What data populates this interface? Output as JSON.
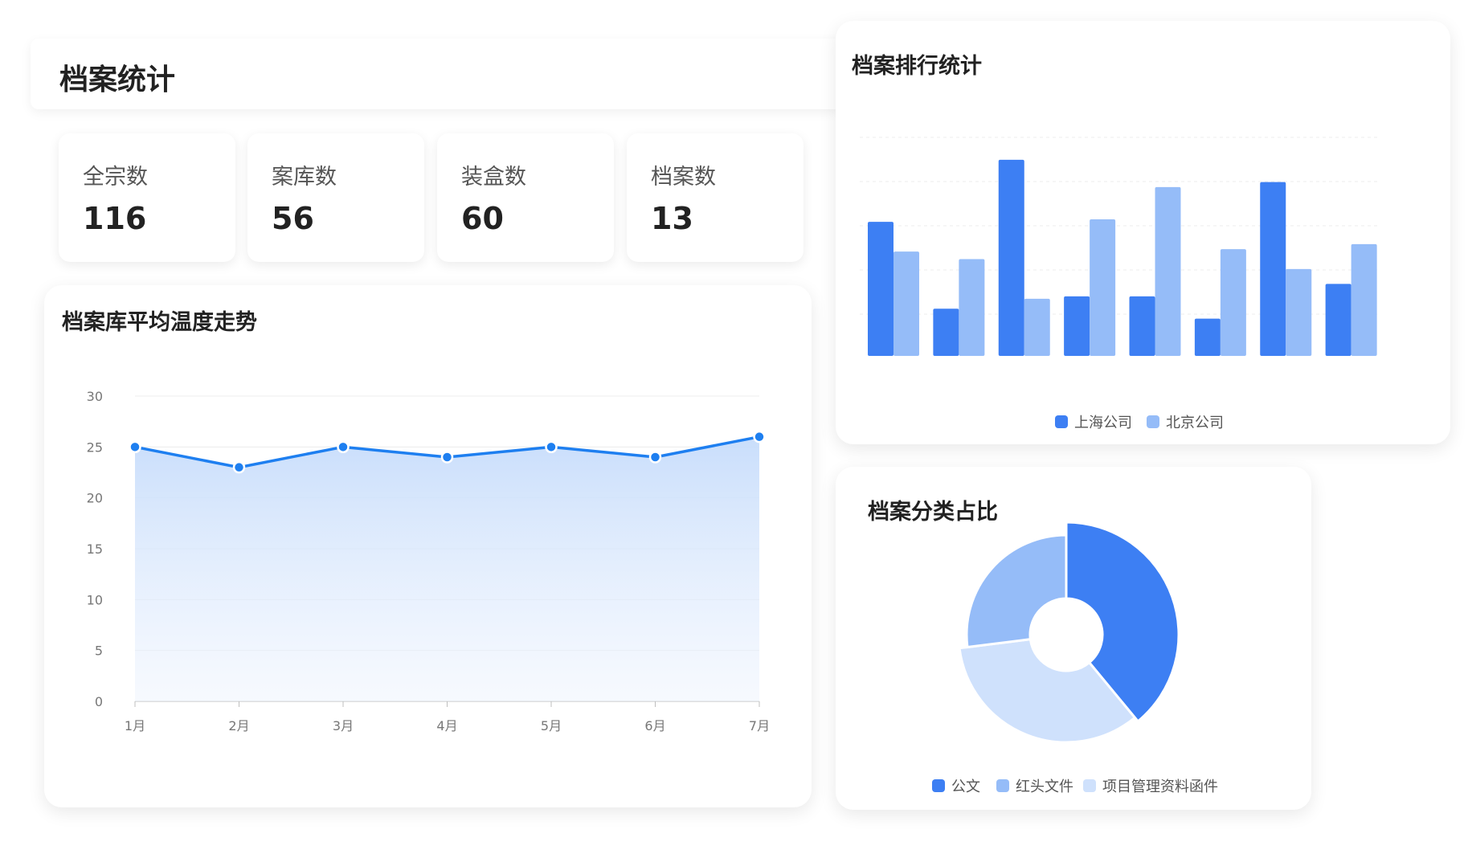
{
  "header": {
    "title": "档案统计"
  },
  "stats": [
    {
      "label": "全宗数",
      "value": "116"
    },
    {
      "label": "案库数",
      "value": "56"
    },
    {
      "label": "装盒数",
      "value": "60"
    },
    {
      "label": "档案数",
      "value": "13"
    }
  ],
  "cards": {
    "temperature": {
      "title": "档案库平均温度走势"
    },
    "ranking": {
      "title": "档案排行统计"
    },
    "category": {
      "title": "档案分类占比"
    }
  },
  "colors": {
    "primary": "#3d7ff3",
    "secondary": "#95bcf8",
    "tertiary": "#cfe1fc",
    "line": "#1e7ff0"
  },
  "chart_data": [
    {
      "type": "area",
      "x": [
        "1月",
        "2月",
        "3月",
        "4月",
        "5月",
        "6月",
        "7月"
      ],
      "values": [
        25,
        23,
        25,
        24,
        25,
        24,
        26
      ],
      "ylim": [
        0,
        30
      ],
      "yticks": [
        0,
        5,
        10,
        15,
        20,
        25,
        30
      ],
      "grid": true
    },
    {
      "type": "bar",
      "categories": [
        "",
        "",
        "",
        "",
        "",
        "",
        "",
        ""
      ],
      "series": [
        {
          "name": "上海公司",
          "values": [
            54,
            19,
            79,
            24,
            24,
            15,
            70,
            29
          ]
        },
        {
          "name": "北京公司",
          "values": [
            42,
            39,
            23,
            55,
            68,
            43,
            35,
            45
          ]
        }
      ],
      "ylim": [
        0,
        88
      ],
      "grid": true,
      "legend": "bottom-center"
    },
    {
      "type": "pie",
      "series": [
        {
          "name": "公文",
          "value": 39
        },
        {
          "name": "红头文件",
          "value": 27
        },
        {
          "name": "项目管理资料函件",
          "value": 34
        }
      ],
      "legend": "bottom-center"
    }
  ]
}
